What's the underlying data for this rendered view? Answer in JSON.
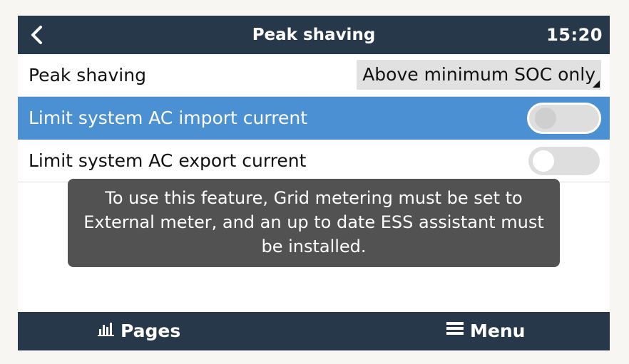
{
  "header": {
    "title": "Peak shaving",
    "time": "15:20"
  },
  "rows": [
    {
      "label": "Peak shaving",
      "value": "Above minimum SOC only"
    },
    {
      "label": "Limit system AC import current",
      "toggle_on": false
    },
    {
      "label": "Limit system AC export current",
      "toggle_on": false
    }
  ],
  "toast": {
    "message": "To use this feature, Grid metering must be set to External meter, and an up to date ESS assistant must be installed."
  },
  "footer": {
    "pages_label": "Pages",
    "menu_label": "Menu"
  },
  "colors": {
    "bar": "#27384a",
    "selected_row": "#4a90d2",
    "toast_bg": "#525252"
  },
  "icons": [
    "back-arrow-icon",
    "bar-chart-icon",
    "hamburger-menu-icon"
  ]
}
